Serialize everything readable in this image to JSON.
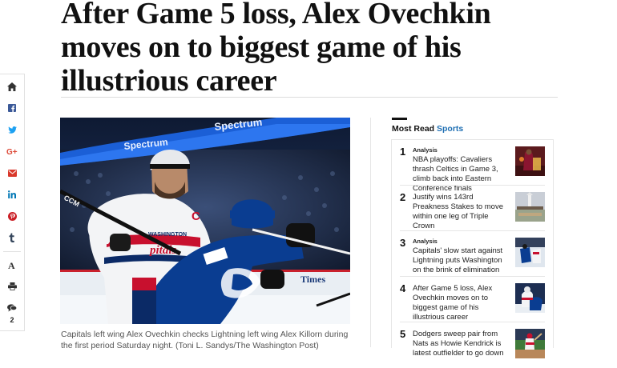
{
  "article": {
    "headline": "After Game 5 loss, Alex Ovechkin moves on to biggest game of his illustrious career",
    "photo": {
      "alt": "Capitals left wing Alex Ovechkin checks Lightning left wing Alex Killorn",
      "scene_text": {
        "spectrum_left": "Spectrum",
        "spectrum_right": "Spectrum",
        "jersey_brand": "CCM",
        "captain_letter": "C",
        "jersey_name": "WASHINGTON",
        "jersey_word": "pitals",
        "board_ad": "Times"
      }
    },
    "caption": "Capitals left wing Alex Ovechkin checks Lightning left wing Alex Killorn during the first period Saturday night. (Toni L. Sandys/The Washington Post)"
  },
  "share_rail": {
    "icons": [
      "home-icon",
      "facebook-icon",
      "twitter-icon",
      "google-plus-icon",
      "email-icon",
      "linkedin-icon",
      "pinterest-icon",
      "tumblr-icon",
      "font-size-icon",
      "print-icon",
      "comments-icon"
    ],
    "comment_count": "2",
    "colors": {
      "facebook": "#3b5998",
      "twitter": "#1da1f2",
      "google_plus": "#dd4b39",
      "email": "#d9382b",
      "linkedin": "#0077b5",
      "pinterest": "#cb2027",
      "tumblr": "#35465c",
      "utility": "#333333"
    }
  },
  "most_read": {
    "label": "Most Read",
    "section": "Sports",
    "accent_color": "#1f6fb3",
    "items": [
      {
        "rank": "1",
        "kicker": "Analysis",
        "title": "NBA playoffs: Cavaliers thrash Celtics in Game 3, climb back into Eastern Conference finals"
      },
      {
        "rank": "2",
        "kicker": "",
        "title": "Justify wins 143rd Preakness Stakes to move within one leg of Triple Crown"
      },
      {
        "rank": "3",
        "kicker": "Analysis",
        "title": "Capitals' slow start against Lightning puts Washington on the brink of elimination"
      },
      {
        "rank": "4",
        "kicker": "",
        "title": "After Game 5 loss, Alex Ovechkin moves on to biggest game of his illustrious career"
      },
      {
        "rank": "5",
        "kicker": "",
        "title": "Dodgers sweep pair from Nats as Howie Kendrick is latest outfielder to go down"
      }
    ]
  }
}
